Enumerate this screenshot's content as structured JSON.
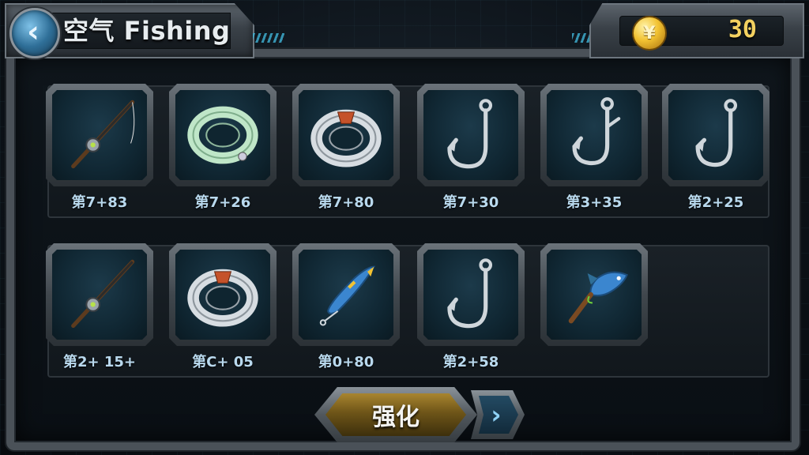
{
  "header": {
    "back_icon": "chevron-left-icon",
    "title": "空气 Fishing"
  },
  "currency": {
    "icon": "yen-coin-icon",
    "coin_symbol": "¥",
    "amount": "30"
  },
  "inventory": {
    "row1": [
      {
        "item": "fishing-rod",
        "label": "第7+83"
      },
      {
        "item": "fishing-line-green",
        "label": "第7+26"
      },
      {
        "item": "fishing-line-spool",
        "label": "第7+80"
      },
      {
        "item": "hook",
        "label": "第7+30"
      },
      {
        "item": "treble-hook",
        "label": "第3+35"
      },
      {
        "item": "hook",
        "label": "第2+25"
      }
    ],
    "row2": [
      {
        "item": "fishing-rod",
        "label": "第2+ 15+"
      },
      {
        "item": "fishing-line-spool",
        "label": "第C+ 05"
      },
      {
        "item": "float-bobber",
        "label": "第0+80"
      },
      {
        "item": "hook",
        "label": "第2+58"
      },
      {
        "item": "fish-lure",
        "label": ""
      }
    ]
  },
  "actions": {
    "upgrade_label": "强化",
    "next_icon": "chevron-right-icon",
    "next_symbol": "›"
  },
  "colors": {
    "accent": "#3fb3d6",
    "coin": "#f3d160",
    "label": "#b9d9ee"
  }
}
